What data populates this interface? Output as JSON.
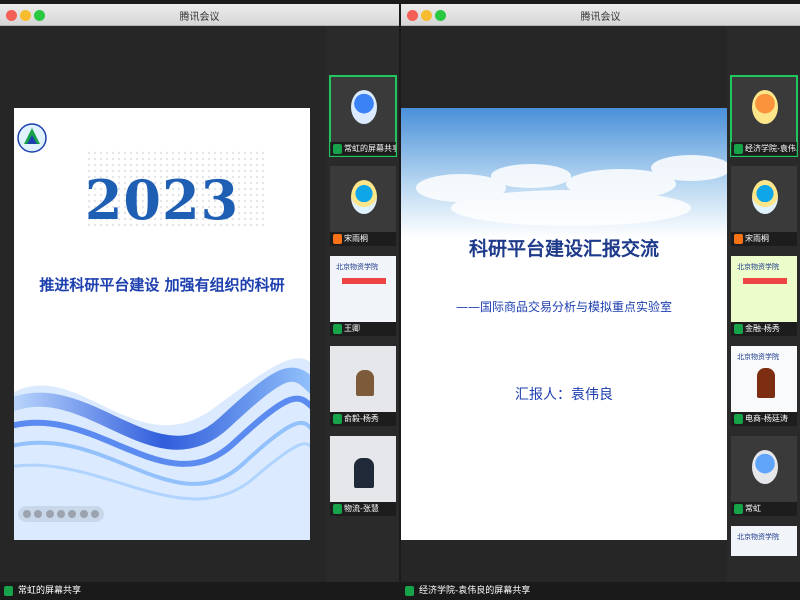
{
  "left_window": {
    "title": "腾讯会议",
    "slide": {
      "year": "2023",
      "headline": "推进科研平台建设 加强有组织的科研"
    },
    "participants": [
      {
        "name": "常虹的屏幕共享",
        "mic": "green",
        "kind": "avatar",
        "active": true
      },
      {
        "name": "宋雨桐",
        "mic": "orange",
        "kind": "avatar",
        "active": false
      },
      {
        "name": "王卿",
        "mic": "green",
        "kind": "school",
        "active": false
      },
      {
        "name": "俞毅-杨秀",
        "mic": "green",
        "kind": "person",
        "active": false
      },
      {
        "name": "物流-张慧",
        "mic": "green",
        "kind": "person",
        "active": false
      }
    ],
    "bottom_label": "常虹的屏幕共享"
  },
  "right_window": {
    "title": "腾讯会议",
    "slide": {
      "title": "科研平台建设汇报交流",
      "subtitle": "——国际商品交易分析与模拟重点实验室",
      "reporter": "汇报人：袁伟良"
    },
    "participants": [
      {
        "name": "经济学院-袁伟...",
        "mic": "green",
        "kind": "avatar",
        "active": true
      },
      {
        "name": "宋雨桐",
        "mic": "orange",
        "kind": "avatar",
        "active": false
      },
      {
        "name": "金融-杨秀",
        "mic": "green",
        "kind": "school",
        "active": false
      },
      {
        "name": "电商-杨廷涛",
        "mic": "green",
        "kind": "person",
        "active": false
      },
      {
        "name": "常虹",
        "mic": "green",
        "kind": "avatar",
        "active": false
      }
    ],
    "bottom_label": "经济学院-袁伟良的屏幕共享"
  },
  "colors": {
    "accent_blue": "#1e5fb3",
    "speaking_green": "#22c55e",
    "muted_orange": "#f97316"
  },
  "icons": [
    "mic-icon",
    "school-logo-icon",
    "slide-tool-icons"
  ]
}
